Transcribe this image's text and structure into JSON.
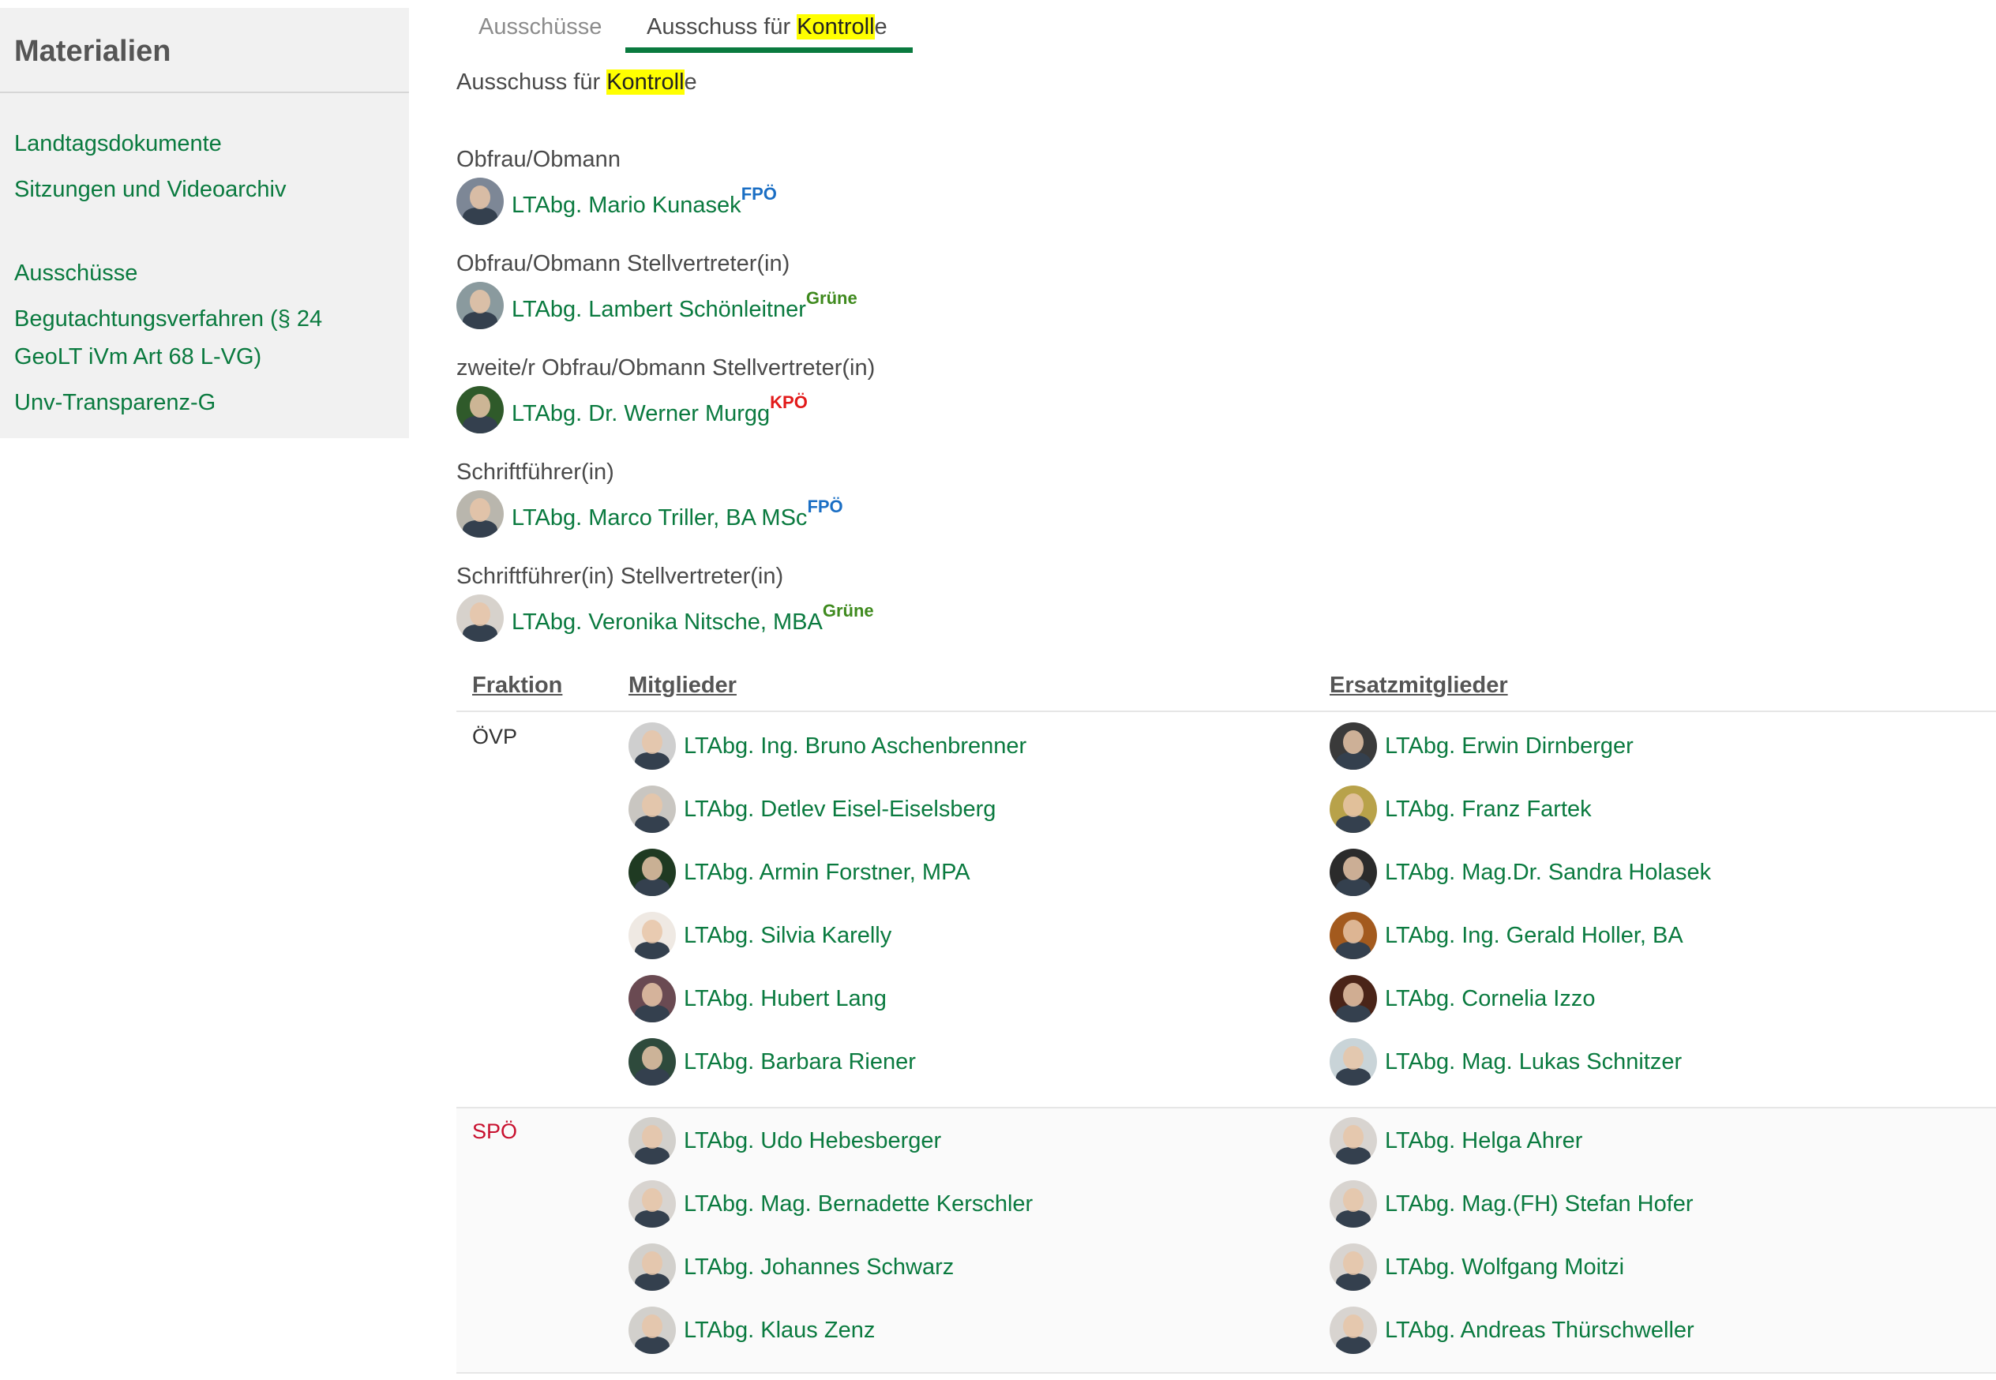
{
  "sidebar": {
    "title": "Materialien",
    "links": [
      "Landtagsdokumente",
      "Sitzungen und Videoarchiv",
      "Ausschüsse",
      "Begutachtungsverfahren (§ 24",
      "GeoLT iVm Art 68 L-VG)",
      "Unv-Transparenz-G"
    ]
  },
  "tabs": {
    "tab1": "Ausschüsse",
    "tab2_prefix": "Ausschuss für ",
    "tab2_highlight": "Kontroll",
    "tab2_suffix": "e"
  },
  "subtitle": {
    "prefix": "Ausschuss für ",
    "highlight": "Kontroll",
    "suffix": "e"
  },
  "roles": [
    {
      "label": "Obfrau/Obmann",
      "name": "LTAbg. Mario Kunasek",
      "party": "FPÖ",
      "avatar_color": "#7d8796"
    },
    {
      "label": "Obfrau/Obmann Stellvertreter(in)",
      "name": "LTAbg. Lambert Schönleitner",
      "party": "Grüne",
      "avatar_color": "#8a9a9e"
    },
    {
      "label": "zweite/r Obfrau/Obmann Stellvertreter(in)",
      "name": "LTAbg. Dr. Werner Murgg",
      "party": "KPÖ",
      "avatar_color": "#2f5a2a"
    },
    {
      "label": "Schriftführer(in)",
      "name": "LTAbg. Marco Triller, BA MSc",
      "party": "FPÖ",
      "avatar_color": "#b9b6ad"
    },
    {
      "label": "Schriftführer(in) Stellvertreter(in)",
      "name": "LTAbg. Veronika Nitsche, MBA",
      "party": "Grüne",
      "avatar_color": "#d7d2cc"
    }
  ],
  "table": {
    "col_fraktion": "Fraktion",
    "col_mitglieder": "Mitglieder",
    "col_ersatz": "Ersatzmitglieder",
    "groups": [
      {
        "fraktion": "ÖVP",
        "fraktion_color": "#333333",
        "members": [
          {
            "name": "LTAbg. Ing. Bruno Aschenbrenner",
            "avatar_color": "#cfcfcf"
          },
          {
            "name": "LTAbg. Detlev Eisel-Eiselsberg",
            "avatar_color": "#c9c6c1"
          },
          {
            "name": "LTAbg. Armin Forstner, MPA",
            "avatar_color": "#1f3a22"
          },
          {
            "name": "LTAbg. Silvia Karelly",
            "avatar_color": "#efe9e3"
          },
          {
            "name": "LTAbg. Hubert Lang",
            "avatar_color": "#6a4a52"
          },
          {
            "name": "LTAbg. Barbara Riener",
            "avatar_color": "#2e4a3c"
          }
        ],
        "substitutes": [
          {
            "name": "LTAbg. Erwin Dirnberger",
            "avatar_color": "#3a3a3a"
          },
          {
            "name": "LTAbg. Franz Fartek",
            "avatar_color": "#b8a24a"
          },
          {
            "name": "LTAbg. Mag.Dr. Sandra Holasek",
            "avatar_color": "#2b2b2b"
          },
          {
            "name": "LTAbg. Ing. Gerald Holler, BA",
            "avatar_color": "#a35a1e"
          },
          {
            "name": "LTAbg. Cornelia Izzo",
            "avatar_color": "#4a2418"
          },
          {
            "name": "LTAbg. Mag. Lukas Schnitzer",
            "avatar_color": "#c9d4d8"
          }
        ]
      },
      {
        "fraktion": "SPÖ",
        "fraktion_color": "#c8102e",
        "members": [
          {
            "name": "LTAbg. Udo Hebesberger",
            "avatar_color": "#d2d0cc"
          },
          {
            "name": "LTAbg. Mag. Bernadette Kerschler",
            "avatar_color": "#d8d4d0"
          },
          {
            "name": "LTAbg. Johannes Schwarz",
            "avatar_color": "#d2d0cc"
          },
          {
            "name": "LTAbg. Klaus Zenz",
            "avatar_color": "#d2d0cc"
          }
        ],
        "substitutes": [
          {
            "name": "LTAbg. Helga Ahrer",
            "avatar_color": "#d8d4d0"
          },
          {
            "name": "LTAbg. Mag.(FH) Stefan Hofer",
            "avatar_color": "#d8d4d0"
          },
          {
            "name": "LTAbg. Wolfgang Moitzi",
            "avatar_color": "#d8d4d0"
          },
          {
            "name": "LTAbg. Andreas Thürschweller",
            "avatar_color": "#d8d4d0"
          }
        ]
      }
    ]
  }
}
